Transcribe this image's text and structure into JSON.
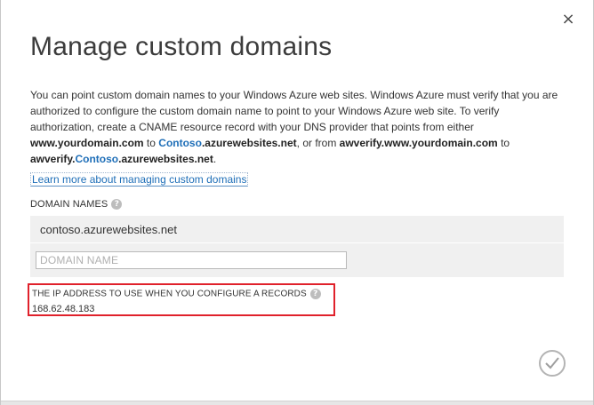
{
  "dialog": {
    "title": "Manage custom domains",
    "close_glyph": "×",
    "description": {
      "intro": "You can point custom domain names to your Windows Azure web sites. Windows Azure must verify that you are authorized to configure the custom domain name to point to your Windows Azure web site. To verify authorization, create a CNAME resource record with your DNS provider that points from either",
      "domain_example": "www.yourdomain.com",
      "to_1": "to",
      "site_name_1": "Contoso",
      "site_suffix_1": ".azurewebsites.net",
      "or_text": ", or from",
      "awverify_domain": "awverify.www.yourdomain.com",
      "to_2": "to",
      "awverify_prefix": "awverify.",
      "site_name_2": "Contoso",
      "site_suffix_2": ".azurewebsites.net",
      "end_punct": "."
    },
    "learn_more_link": "Learn more about managing custom domains",
    "domain_names_label": "DOMAIN NAMES",
    "help_glyph": "?",
    "existing_domain": "contoso.azurewebsites.net",
    "domain_input": {
      "placeholder": "DOMAIN NAME",
      "value": ""
    },
    "ip_section": {
      "label": "THE IP ADDRESS TO USE WHEN YOU CONFIGURE A RECORDS",
      "value": "168.62.48.183",
      "highlight_color": "#e0212b"
    },
    "ok_icon": "checkmark-icon"
  }
}
